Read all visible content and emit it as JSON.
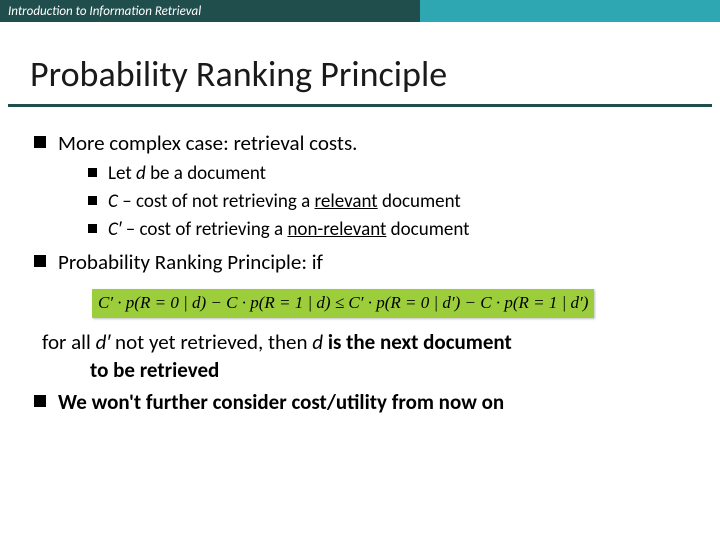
{
  "header": {
    "course": "Introduction to Information Retrieval"
  },
  "title": "Probability Ranking Principle",
  "bullets": {
    "b1": "More complex case: retrieval costs.",
    "b1a_pre": "Let ",
    "b1a_var": "d",
    "b1a_post": " be a document",
    "b1b_var": "C",
    "b1b_mid": " – cost of not retrieving a ",
    "b1b_under": "relevant",
    "b1b_post": " document",
    "b1c_var": "C′",
    "b1c_mid": " – cost of retrieving a ",
    "b1c_under": "non-relevant",
    "b1c_post": " document",
    "b2": "Probability Ranking Principle: if"
  },
  "formula": {
    "text": "C′ · p(R = 0 | d) − C · p(R = 1 | d) ≤ C′ · p(R = 0 | d′) − C · p(R = 1 | d′)"
  },
  "conclusion": {
    "line1_pre": "for all ",
    "line1_var": "d′",
    "line1_mid": " not yet retrieved, then ",
    "line1_var2": "d",
    "line1_bold": " is the next document",
    "line2_bold": "to be retrieved",
    "b3": "We won't further consider cost/utility from now on"
  }
}
